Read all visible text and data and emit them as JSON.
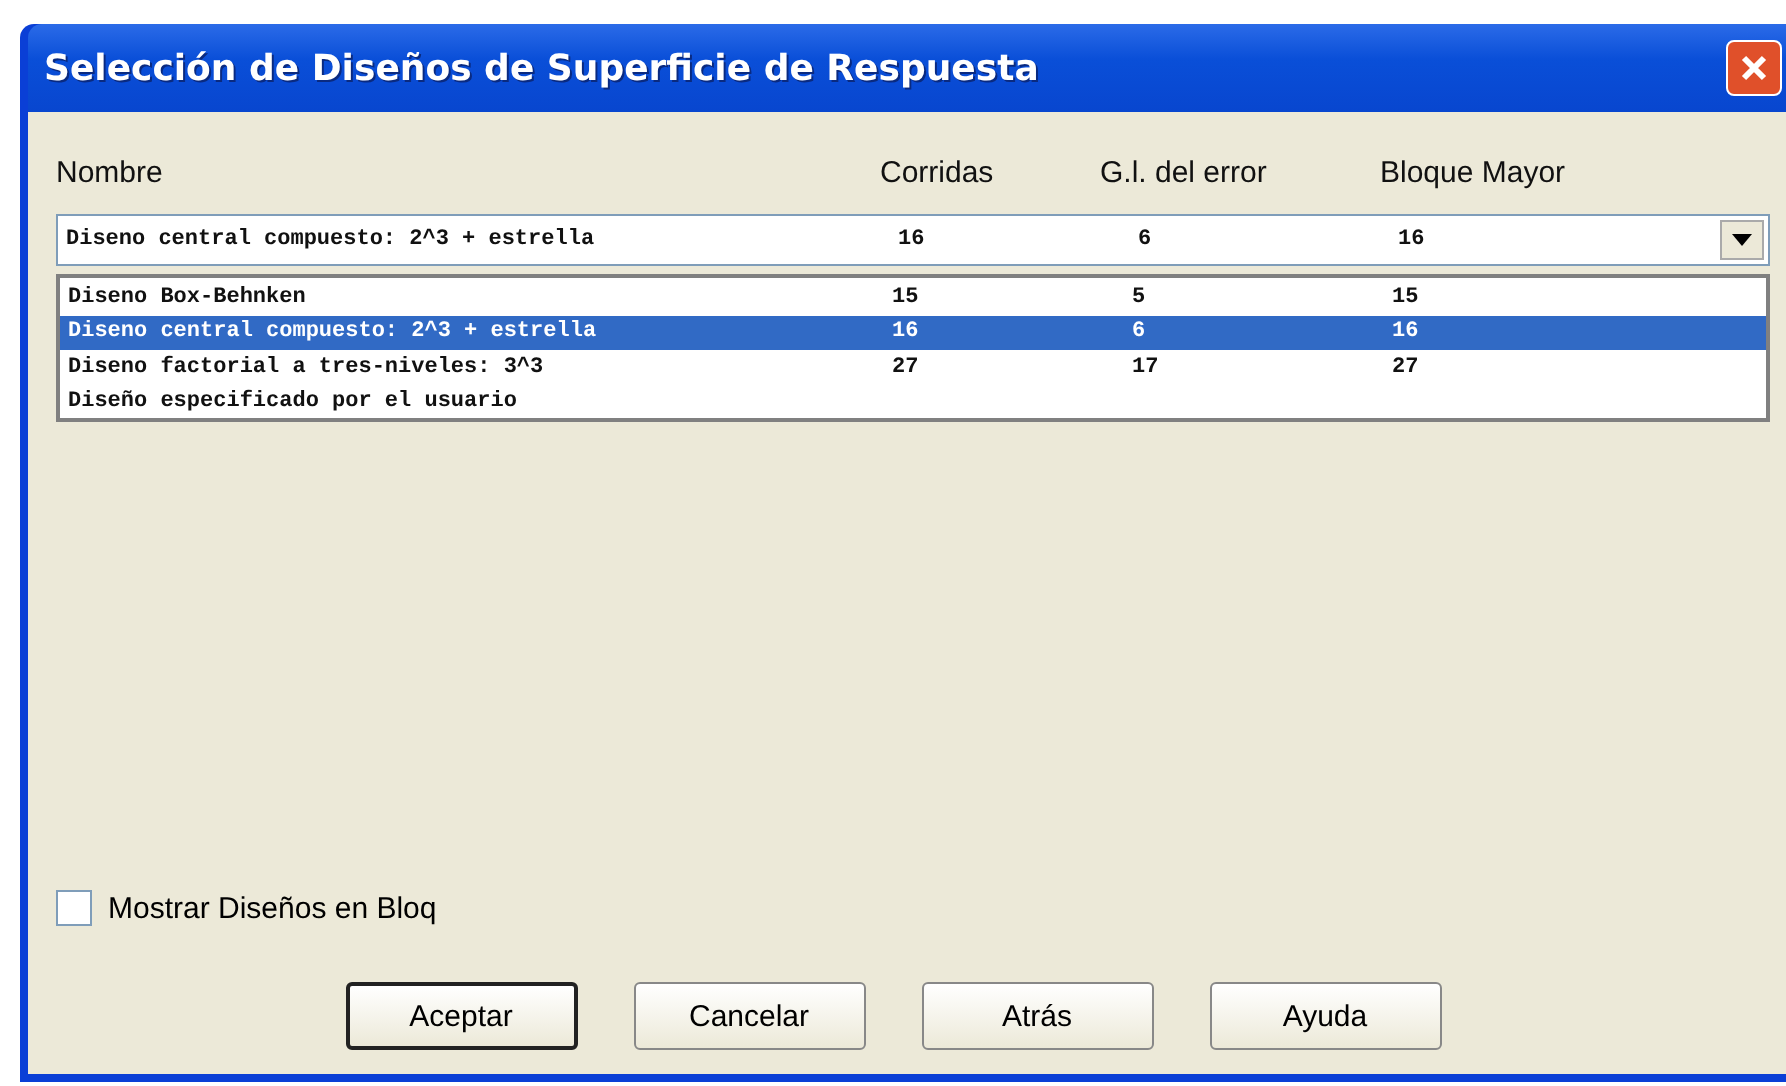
{
  "window": {
    "title": "Selección de Diseños de Superficie de Respuesta"
  },
  "columns": [
    "Nombre",
    "Corridas",
    "G.l. del error",
    "Bloque Mayor"
  ],
  "combo": {
    "value": [
      "Diseno central compuesto: 2^3 + estrella",
      "16",
      "6",
      "16"
    ]
  },
  "options": [
    {
      "cells": [
        "Diseno Box-Behnken",
        "15",
        "5",
        "15"
      ],
      "selected": false
    },
    {
      "cells": [
        "Diseno central compuesto: 2^3 + estrella",
        "16",
        "6",
        "16"
      ],
      "selected": true
    },
    {
      "cells": [
        "Diseno factorial a tres-niveles: 3^3",
        "27",
        "17",
        "27"
      ],
      "selected": false
    },
    {
      "cells": [
        "Diseño especificado por el usuario"
      ],
      "selected": false
    }
  ],
  "checkbox": {
    "label": "Mostrar Diseños en Bloq",
    "checked": false
  },
  "buttons": [
    {
      "label": "Aceptar",
      "default": true
    },
    {
      "label": "Cancelar",
      "default": false
    },
    {
      "label": "Atrás",
      "default": false
    },
    {
      "label": "Ayuda",
      "default": false
    }
  ]
}
